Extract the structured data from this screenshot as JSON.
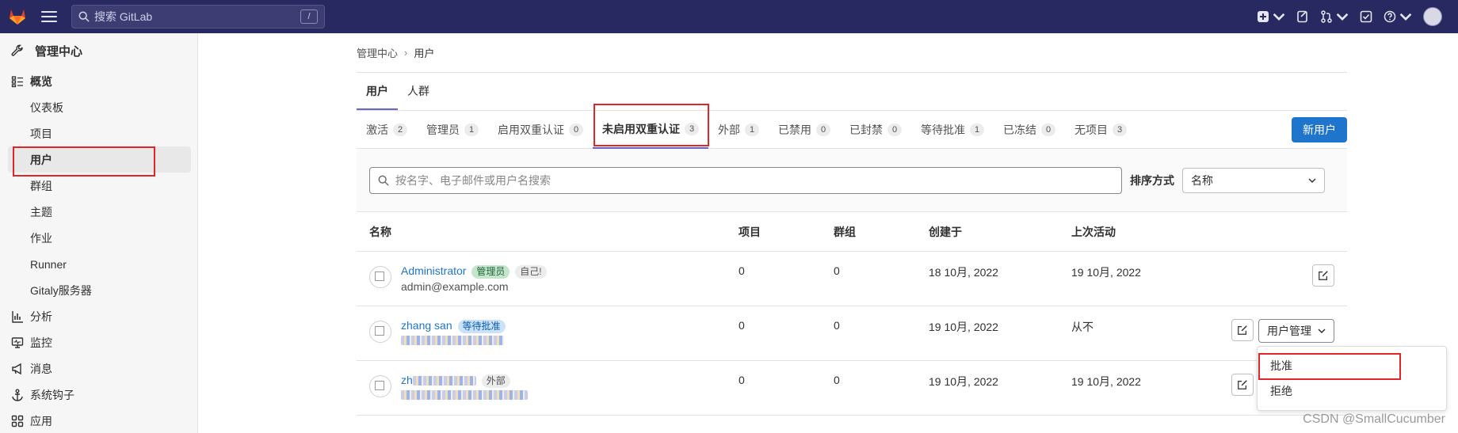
{
  "topbar": {
    "search_placeholder": "搜索 GitLab",
    "search_shortcut": "/"
  },
  "sidebar": {
    "header": "管理中心",
    "overview": "概览",
    "items": [
      "仪表板",
      "项目",
      "用户",
      "群组",
      "主题",
      "作业",
      "Runner",
      "Gitaly服务器"
    ],
    "sections": [
      "分析",
      "监控",
      "消息",
      "系统钩子",
      "应用"
    ]
  },
  "breadcrumb": {
    "root": "管理中心",
    "current": "用户"
  },
  "main_tabs": [
    "用户",
    "人群"
  ],
  "filter_tabs": [
    {
      "label": "激活",
      "count": "2"
    },
    {
      "label": "管理员",
      "count": "1"
    },
    {
      "label": "启用双重认证",
      "count": "0"
    },
    {
      "label": "未启用双重认证",
      "count": "3"
    },
    {
      "label": "外部",
      "count": "1"
    },
    {
      "label": "已禁用",
      "count": "0"
    },
    {
      "label": "已封禁",
      "count": "0"
    },
    {
      "label": "等待批准",
      "count": "1"
    },
    {
      "label": "已冻结",
      "count": "0"
    },
    {
      "label": "无项目",
      "count": "3"
    }
  ],
  "new_user_button": "新用户",
  "filter": {
    "search_placeholder": "按名字、电子邮件或用户名搜索",
    "sort_label": "排序方式",
    "sort_value": "名称"
  },
  "table": {
    "headers": [
      "名称",
      "项目",
      "群组",
      "创建于",
      "上次活动"
    ],
    "rows": [
      {
        "name": "Administrator",
        "badges": [
          "管理员",
          "自己!"
        ],
        "email": "admin@example.com",
        "projects": "0",
        "groups": "0",
        "created": "18 10月, 2022",
        "last": "19 10月, 2022"
      },
      {
        "name": "zhang san",
        "badges": [
          "等待批准"
        ],
        "email": "",
        "projects": "0",
        "groups": "0",
        "created": "19 10月, 2022",
        "last": "从不"
      },
      {
        "name": "zh",
        "badges": [
          "外部"
        ],
        "email": "",
        "projects": "0",
        "groups": "0",
        "created": "19 10月, 2022",
        "last": "19 10月, 2022"
      }
    ]
  },
  "user_mgmt_button": "用户管理",
  "dropdown": [
    "批准",
    "拒绝"
  ],
  "watermark": "CSDN @SmallCucumber",
  "colors": {
    "topbar": "#292961",
    "accent": "#1f75cb",
    "highlight": "#e0252b"
  }
}
